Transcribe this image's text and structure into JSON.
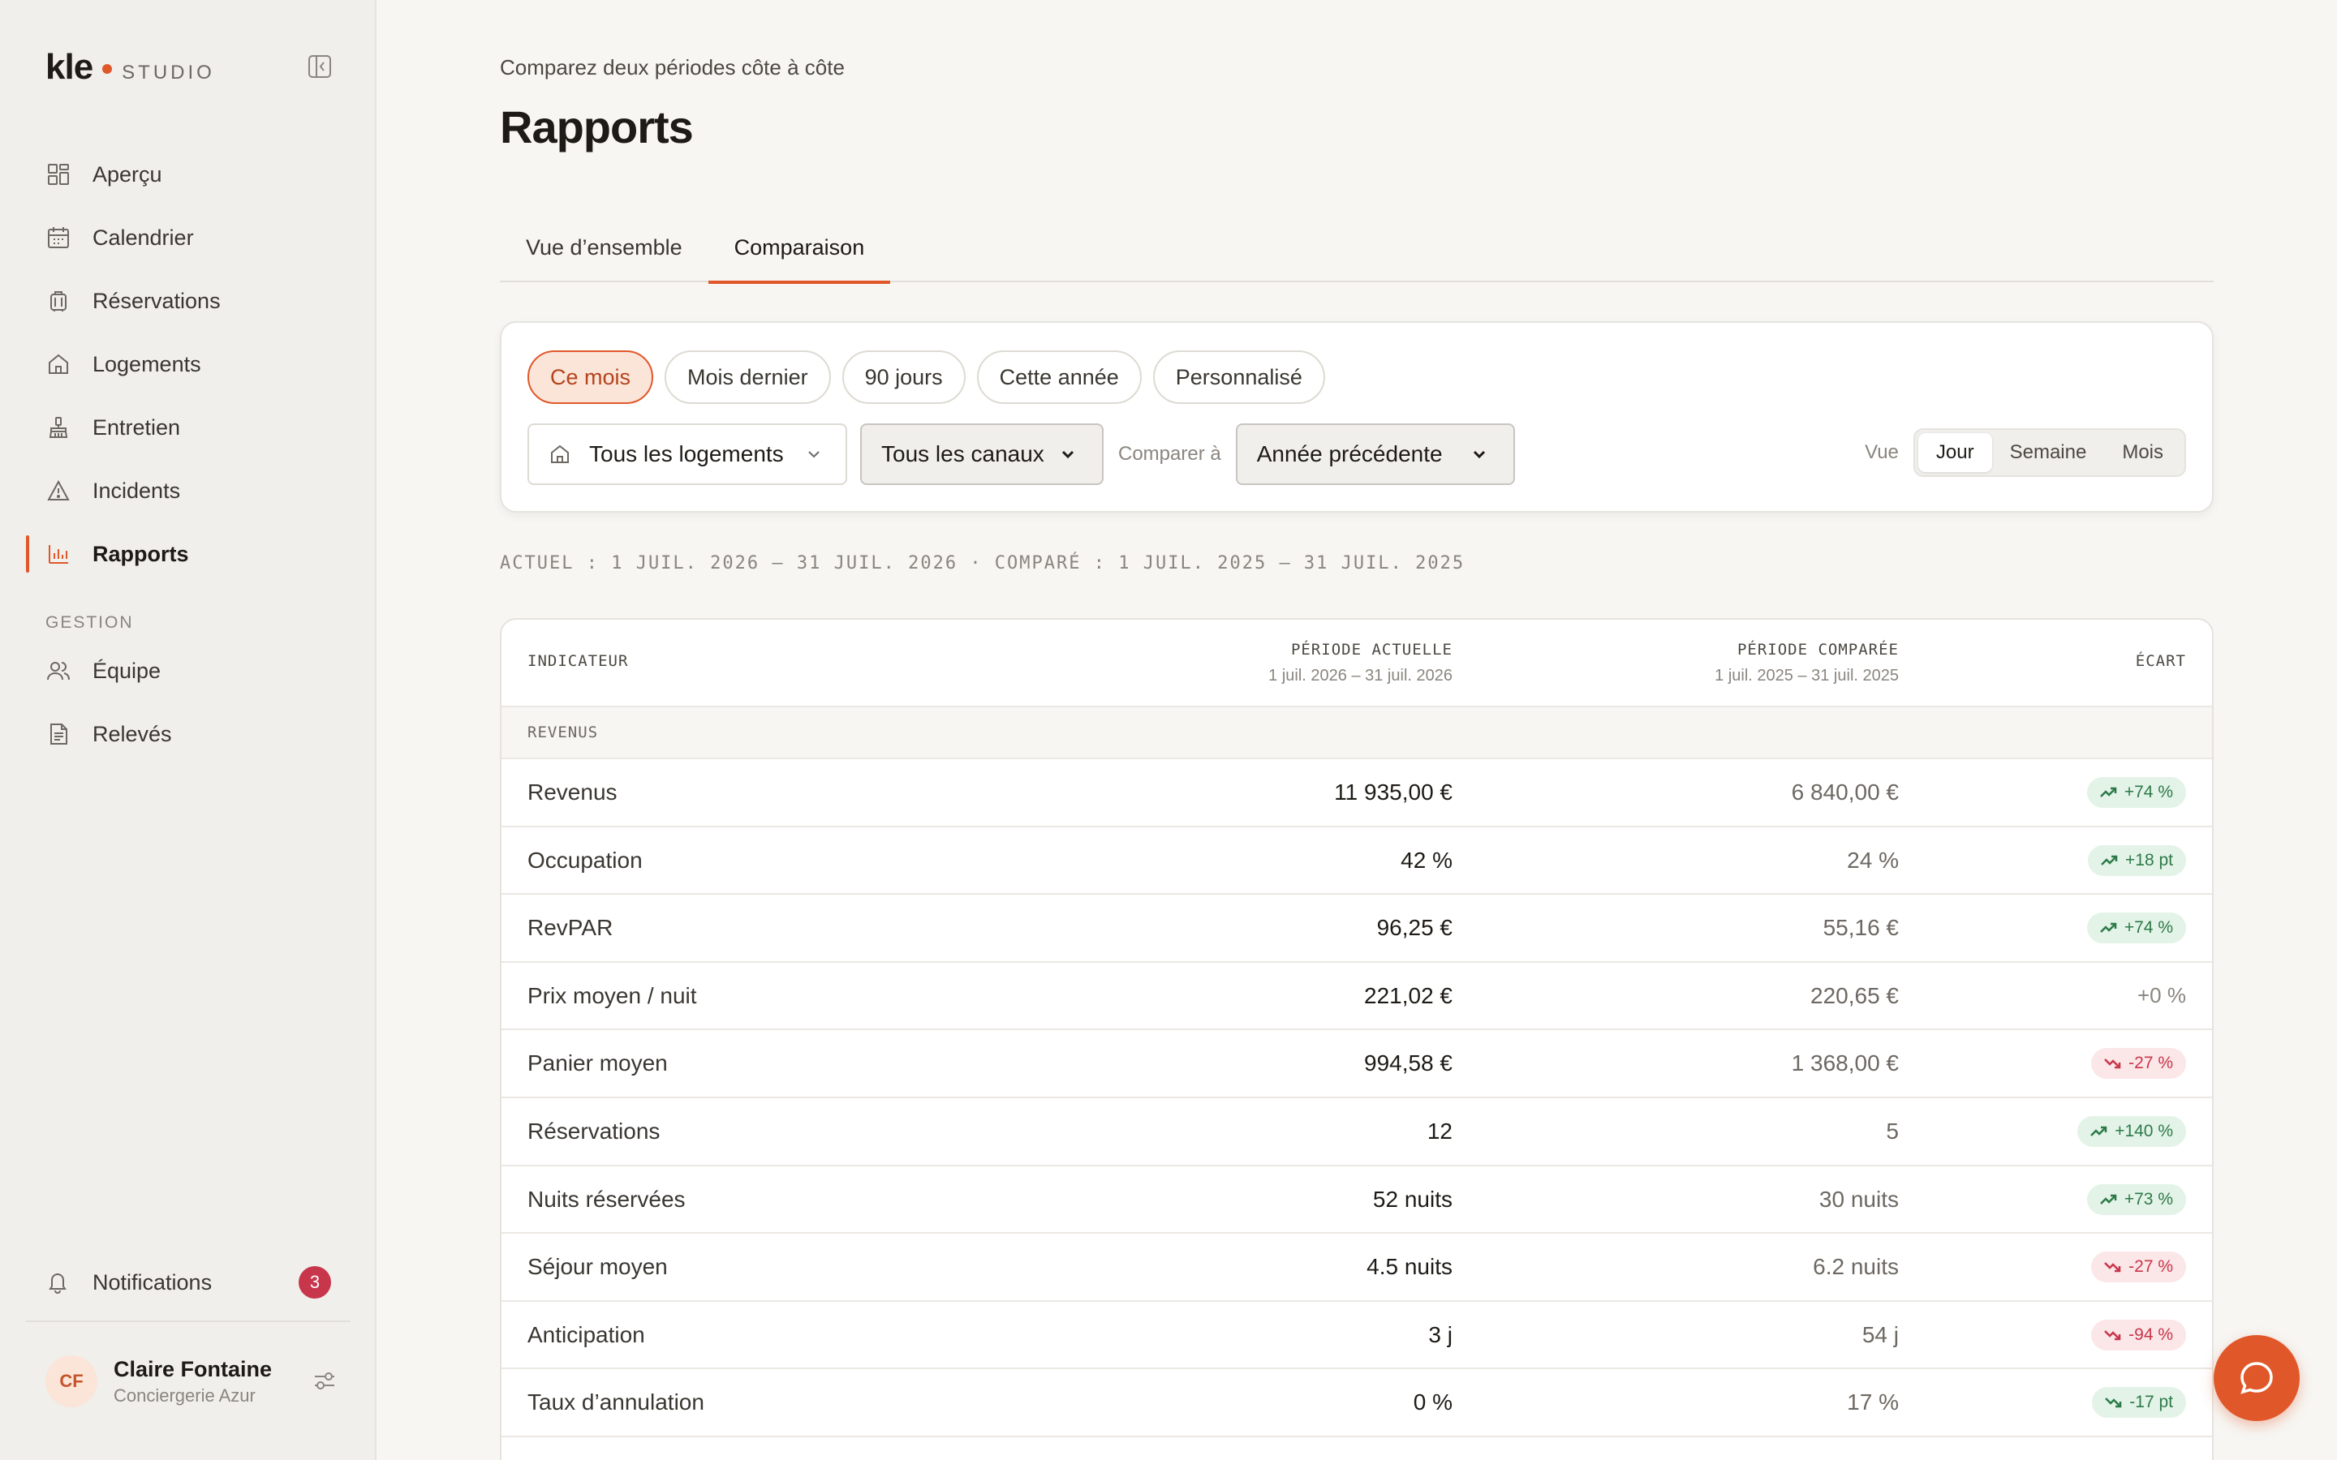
{
  "brand": {
    "name": "kle",
    "suffix": "STUDIO"
  },
  "sidebar": {
    "items": [
      {
        "label": "Aperçu",
        "icon": "grid-icon"
      },
      {
        "label": "Calendrier",
        "icon": "calendar-icon"
      },
      {
        "label": "Réservations",
        "icon": "luggage-icon"
      },
      {
        "label": "Logements",
        "icon": "home-icon"
      },
      {
        "label": "Entretien",
        "icon": "broom-icon"
      },
      {
        "label": "Incidents",
        "icon": "warning-icon"
      },
      {
        "label": "Rapports",
        "icon": "bar-chart-icon",
        "active": true
      }
    ],
    "section_label": "GESTION",
    "section_items": [
      {
        "label": "Équipe",
        "icon": "users-icon"
      },
      {
        "label": "Relevés",
        "icon": "document-icon"
      }
    ],
    "notifications": {
      "label": "Notifications",
      "count": "3"
    },
    "user": {
      "initials": "CF",
      "name": "Claire Fontaine",
      "org": "Conciergerie Azur"
    }
  },
  "header": {
    "subtitle": "Comparez deux périodes côte à côte",
    "title": "Rapports",
    "tabs": [
      {
        "label": "Vue d’ensemble",
        "active": false
      },
      {
        "label": "Comparaison",
        "active": true
      }
    ]
  },
  "filters": {
    "presets": [
      "Ce mois",
      "Mois dernier",
      "90 jours",
      "Cette année",
      "Personnalisé"
    ],
    "active_preset": "Ce mois",
    "property_select": "Tous les logements",
    "channel_select": "Tous les canaux",
    "compare_label": "Comparer à",
    "compare_select": "Année précédente",
    "view_label": "Vue",
    "view_options": [
      "Jour",
      "Semaine",
      "Mois"
    ],
    "active_view": "Jour"
  },
  "period_line": "ACTUEL : 1 JUIL. 2026 – 31 JUIL. 2026 · COMPARÉ : 1 JUIL. 2025 – 31 JUIL. 2025",
  "table": {
    "headers": {
      "indicator": "INDICATEUR",
      "current": "PÉRIODE ACTUELLE",
      "current_range": "1 juil. 2026 – 31 juil. 2026",
      "compared": "PÉRIODE COMPARÉE",
      "compared_range": "1 juil. 2025 – 31 juil. 2025",
      "delta": "ÉCART"
    },
    "section": "REVENUS",
    "rows": [
      {
        "label": "Revenus",
        "current": "11 935,00 €",
        "compared": "6 840,00 €",
        "delta": "+74 %",
        "trend": "up"
      },
      {
        "label": "Occupation",
        "current": "42 %",
        "compared": "24 %",
        "delta": "+18 pt",
        "trend": "up"
      },
      {
        "label": "RevPAR",
        "current": "96,25 €",
        "compared": "55,16 €",
        "delta": "+74 %",
        "trend": "up"
      },
      {
        "label": "Prix moyen / nuit",
        "current": "221,02 €",
        "compared": "220,65 €",
        "delta": "+0 %",
        "trend": "neutral"
      },
      {
        "label": "Panier moyen",
        "current": "994,58 €",
        "compared": "1 368,00 €",
        "delta": "-27 %",
        "trend": "down"
      },
      {
        "label": "Réservations",
        "current": "12",
        "compared": "5",
        "delta": "+140 %",
        "trend": "up"
      },
      {
        "label": "Nuits réservées",
        "current": "52 nuits",
        "compared": "30 nuits",
        "delta": "+73 %",
        "trend": "up"
      },
      {
        "label": "Séjour moyen",
        "current": "4.5 nuits",
        "compared": "6.2 nuits",
        "delta": "-27 %",
        "trend": "down"
      },
      {
        "label": "Anticipation",
        "current": "3 j",
        "compared": "54 j",
        "delta": "-94 %",
        "trend": "down"
      },
      {
        "label": "Taux d’annulation",
        "current": "0 %",
        "compared": "17 %",
        "delta": "-17 pt",
        "trend": "good-down"
      }
    ]
  },
  "colors": {
    "accent": "#e0582a",
    "positive": "#2d7a48",
    "negative": "#c8364b",
    "badge": "#c8364b"
  }
}
